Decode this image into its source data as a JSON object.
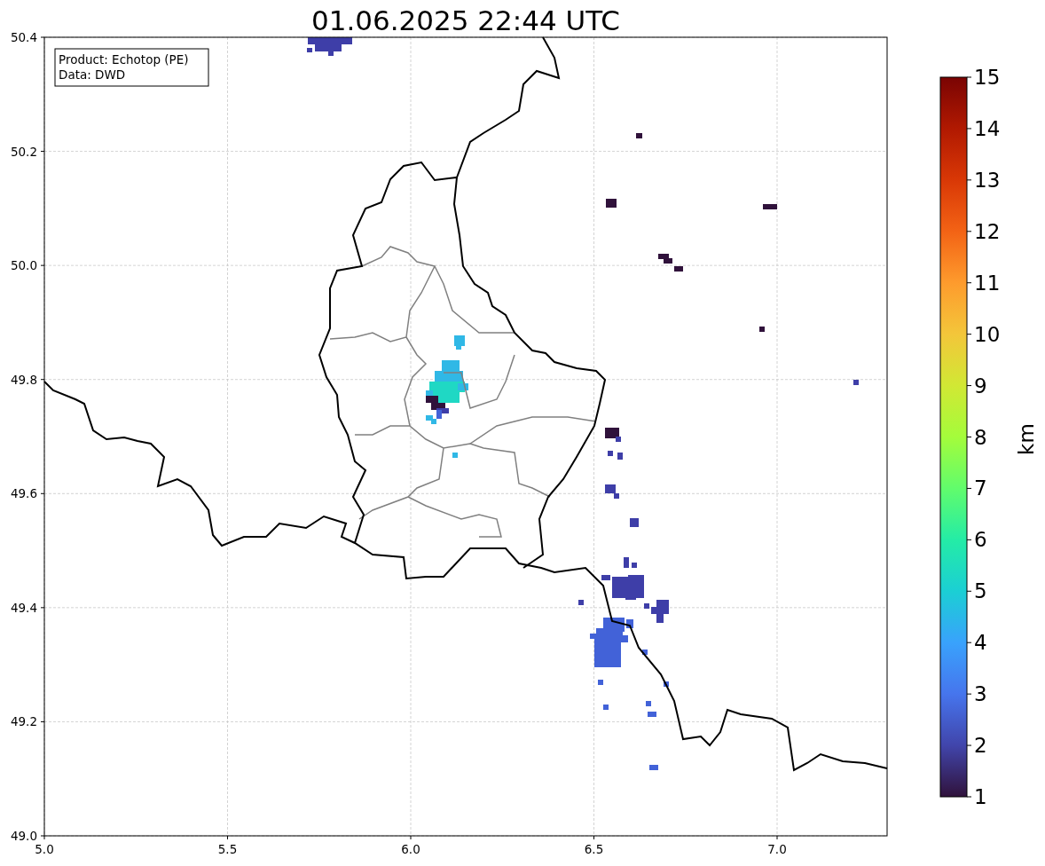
{
  "title": "01.06.2025 22:44 UTC",
  "info_box": [
    "Product: Echotop (PE)",
    "Data: DWD"
  ],
  "x_axis": {
    "ticks": [
      "5.0",
      "5.5",
      "6.0",
      "6.5",
      "7.0"
    ]
  },
  "y_axis": {
    "ticks": [
      "50.4",
      "50.2",
      "50.0",
      "49.8",
      "49.6",
      "49.4",
      "49.2",
      "49.0"
    ]
  },
  "colorbar": {
    "label": "km",
    "ticks": [
      "15",
      "14",
      "13",
      "12",
      "11",
      "10",
      "9",
      "8",
      "7",
      "6",
      "5",
      "4",
      "3",
      "2",
      "1"
    ]
  }
}
